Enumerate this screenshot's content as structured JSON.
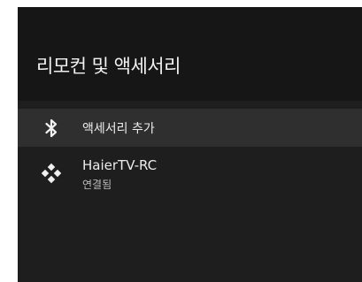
{
  "screen": {
    "title": "리모컨 및 액세서리"
  },
  "items": [
    {
      "icon": "bluetooth-icon",
      "label": "액세서리 추가"
    },
    {
      "icon": "gamepad-icon",
      "label": "HaierTV-RC",
      "status": "연결됨"
    }
  ],
  "colors": {
    "background": "#1e1e1e",
    "header": "#161616",
    "selected": "#2f2f2f",
    "text": "#ececec"
  }
}
